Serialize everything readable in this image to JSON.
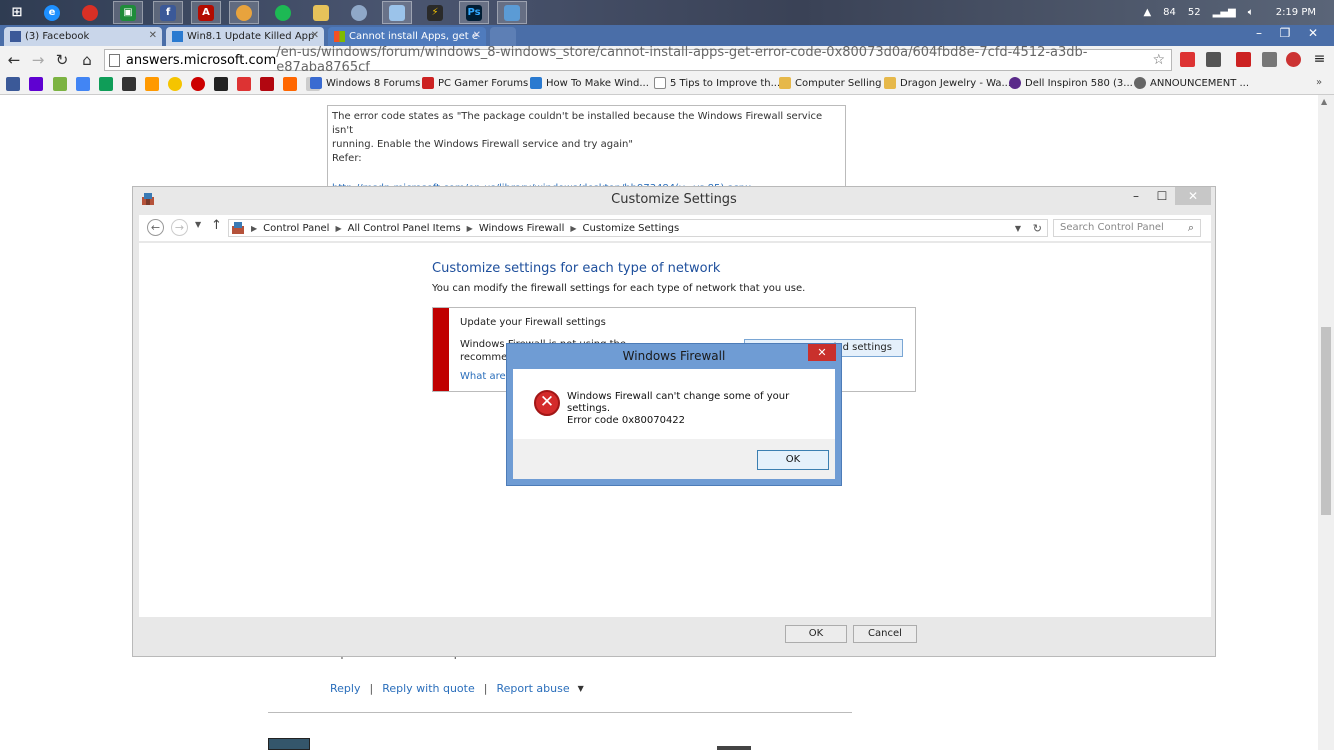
{
  "taskbar": {
    "apps": [
      "windows-start",
      "internet-explorer",
      "chrome",
      "excel-like-app",
      "facebook-app",
      "adobe-reader",
      "chrome-2",
      "spotify",
      "file-explorer",
      "network-tool",
      "notepad",
      "winamp",
      "photoshop",
      "remote-desktop"
    ],
    "tray": {
      "temp1": "84",
      "temp2": "52",
      "time": "2:19 PM"
    }
  },
  "browser": {
    "tabs": [
      {
        "title": "(3) Facebook",
        "icon": "facebook-icon"
      },
      {
        "title": "Win8.1 Update Killed App",
        "icon": "windows-flag-icon"
      },
      {
        "title": "Cannot install Apps, get e",
        "icon": "microsoft-logo-icon",
        "active": true
      }
    ],
    "url_host": "answers.microsoft.com",
    "url_path": "/en-us/windows/forum/windows_8-windows_store/cannot-install-apps-get-error-code-0x80073d0a/604fbd8e-7cfd-4512-a3db-e87aba8765cf",
    "bookmarks": [
      {
        "label": "Windows 8 Forums",
        "color": "#3a6bd1"
      },
      {
        "label": "PC Gamer Forums",
        "color": "#cc2222"
      },
      {
        "label": "How To Make Wind...",
        "color": "#2a7ad0"
      },
      {
        "label": "5 Tips to Improve th...",
        "color": "#888888"
      },
      {
        "label": "Computer Selling",
        "color": "#e6b84a"
      },
      {
        "label": "Dragon Jewelry - Wa...",
        "color": "#e6b84a"
      },
      {
        "label": "Dell Inspiron 580 (3...",
        "color": "#5a2a8a"
      },
      {
        "label": "ANNOUNCEMENT ...",
        "color": "#666666"
      }
    ]
  },
  "page": {
    "quote_line1": "The error code states as \"The package couldn't be installed because the Windows Firewall service isn't",
    "quote_line2": "running. Enable the Windows Firewall service and try again\"",
    "quote_refer": "Refer:",
    "quote_link": "http://msdn.microsoft.com/en-us/library/windows/desktop/hh973484(v=vs.85).aspx",
    "hope_text": "Hope this information helps.",
    "reply": "Reply",
    "reply_quote": "Reply with quote",
    "report_abuse": "Report abuse",
    "sep": "|"
  },
  "settings_window": {
    "title": "Customize Settings",
    "breadcrumb": [
      "Control Panel",
      "All Control Panel Items",
      "Windows Firewall",
      "Customize Settings"
    ],
    "search_placeholder": "Search Control Panel",
    "heading": "Customize settings for each type of network",
    "subheading": "You can modify the firewall settings for each type of network that you use.",
    "warning_title": "Update your Firewall settings",
    "warning_text": "Windows Firewall is not using the recommended settings to",
    "warning_link": "What are t",
    "warning_button": "led settings",
    "ok": "OK",
    "cancel": "Cancel"
  },
  "error_dialog": {
    "title": "Windows Firewall",
    "line1": "Windows Firewall can't change some of your settings.",
    "line2": "Error code 0x80070422",
    "ok": "OK"
  }
}
